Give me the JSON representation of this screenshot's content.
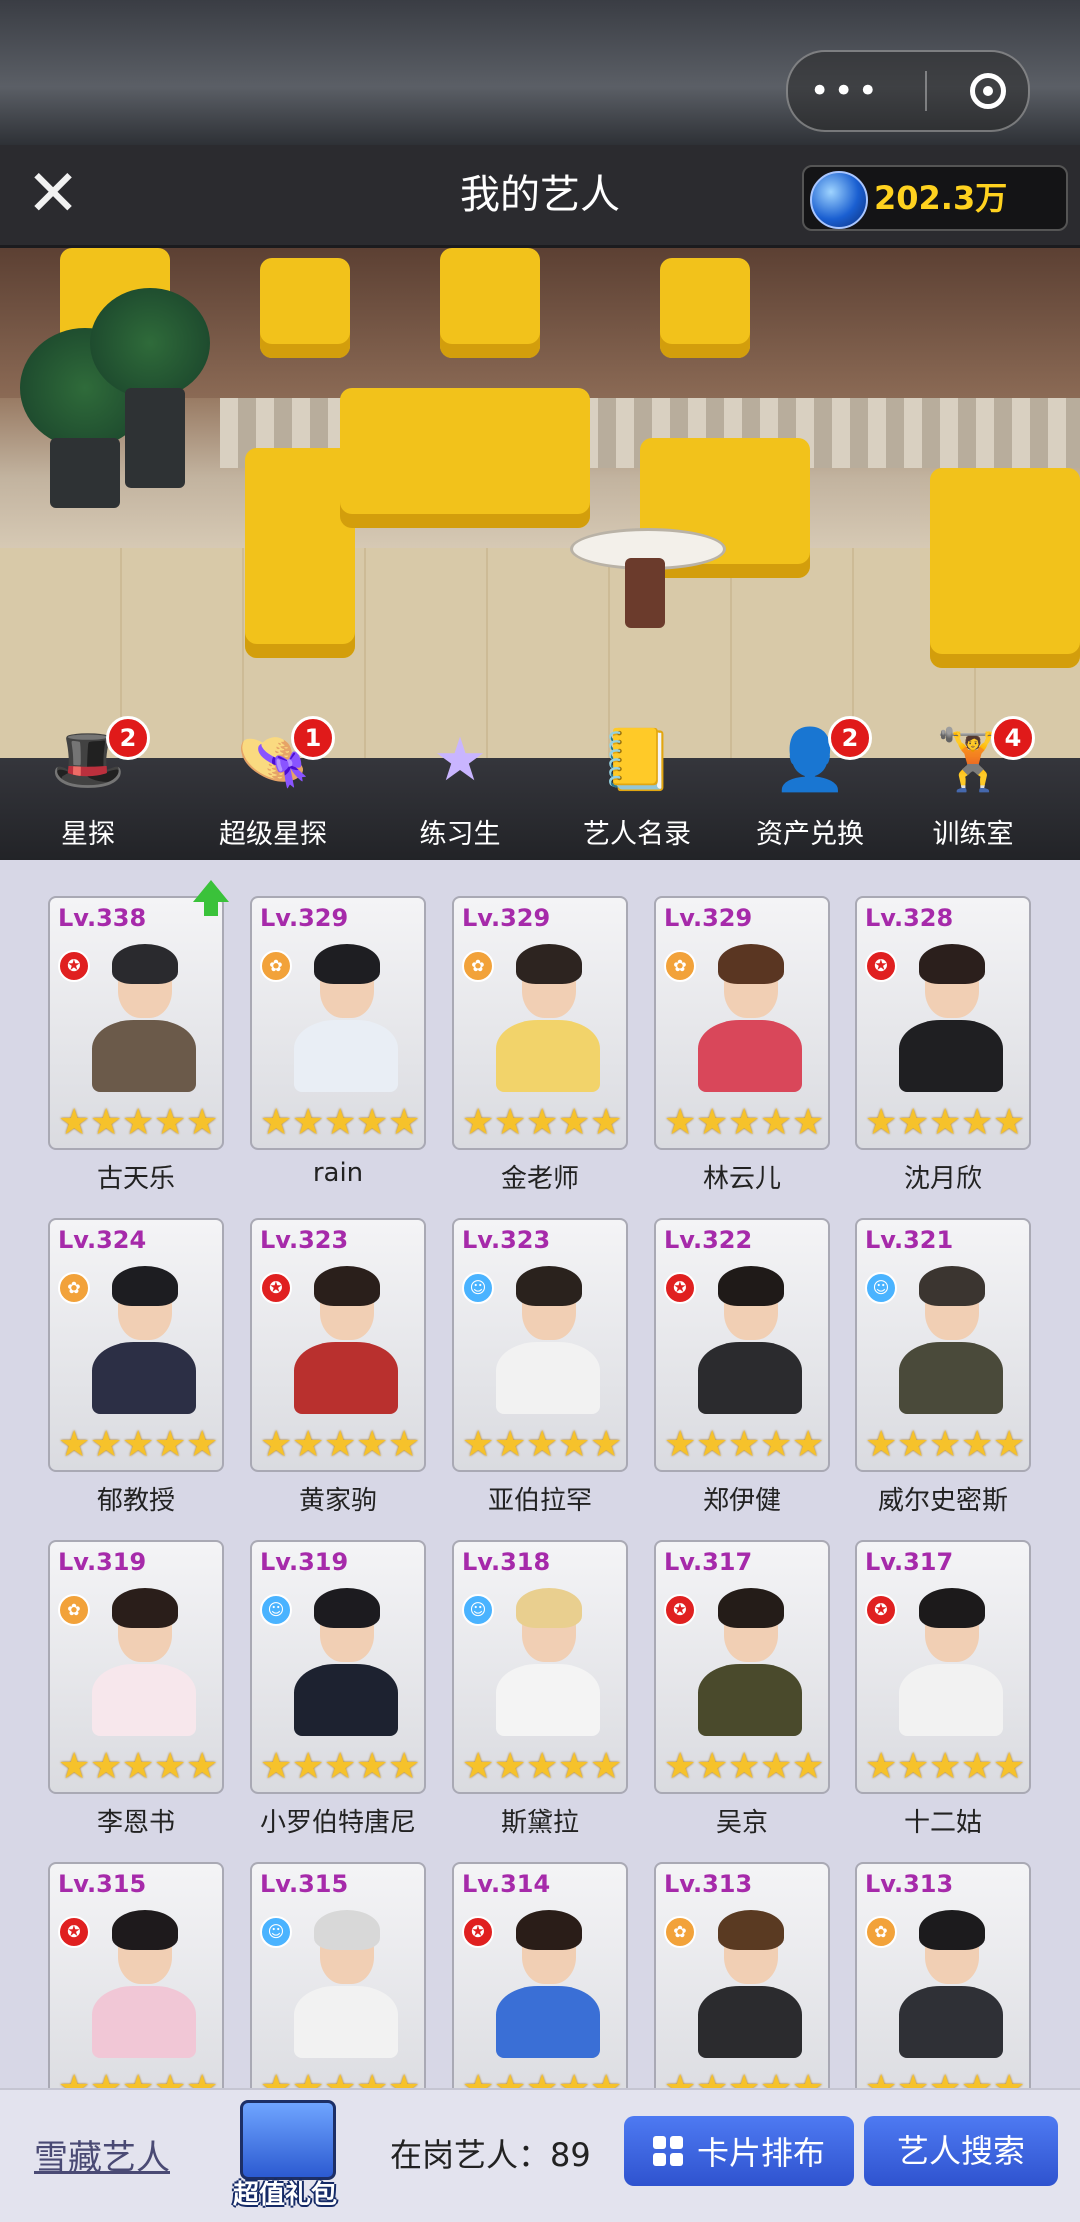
{
  "header": {
    "title": "我的艺人",
    "coins": "202.3万"
  },
  "capsule": {
    "more_icon": "more-dots-icon",
    "close_icon": "target-icon"
  },
  "actions": [
    {
      "label": "星探",
      "badge": "2",
      "icon": "scout-hat-icon"
    },
    {
      "label": "超级星探",
      "badge": "1",
      "icon": "super-scout-hat-icon"
    },
    {
      "label": "练习生",
      "badge": "",
      "icon": "trainee-star-icon"
    },
    {
      "label": "艺人名录",
      "badge": "",
      "icon": "directory-book-icon"
    },
    {
      "label": "资产兑换",
      "badge": "2",
      "icon": "asset-exchange-icon"
    },
    {
      "label": "训练室",
      "badge": "4",
      "icon": "dumbbell-icon"
    }
  ],
  "artists": [
    {
      "level": "Lv.338",
      "name": "古天乐",
      "emblem": "red",
      "up": true
    },
    {
      "level": "Lv.329",
      "name": "rain",
      "emblem": "orange",
      "up": false
    },
    {
      "level": "Lv.329",
      "name": "金老师",
      "emblem": "orange",
      "up": false
    },
    {
      "level": "Lv.329",
      "name": "林云儿",
      "emblem": "orange",
      "up": false
    },
    {
      "level": "Lv.328",
      "name": "沈月欣",
      "emblem": "red",
      "up": false
    },
    {
      "level": "Lv.324",
      "name": "郁教授",
      "emblem": "orange",
      "up": false
    },
    {
      "level": "Lv.323",
      "name": "黄家驹",
      "emblem": "red",
      "up": false
    },
    {
      "level": "Lv.323",
      "name": "亚伯拉罕",
      "emblem": "blue",
      "up": false
    },
    {
      "level": "Lv.322",
      "name": "郑伊健",
      "emblem": "red",
      "up": false
    },
    {
      "level": "Lv.321",
      "name": "威尔史密斯",
      "emblem": "blue",
      "up": false
    },
    {
      "level": "Lv.319",
      "name": "李恩书",
      "emblem": "orange",
      "up": false
    },
    {
      "level": "Lv.319",
      "name": "小罗伯特唐尼",
      "emblem": "blue",
      "up": false
    },
    {
      "level": "Lv.318",
      "name": "斯黛拉",
      "emblem": "blue",
      "up": false
    },
    {
      "level": "Lv.317",
      "name": "吴京",
      "emblem": "red",
      "up": false
    },
    {
      "level": "Lv.317",
      "name": "十二姑",
      "emblem": "red",
      "up": false
    },
    {
      "level": "Lv.315",
      "name": "",
      "emblem": "red",
      "up": false
    },
    {
      "level": "Lv.315",
      "name": "",
      "emblem": "blue",
      "up": false
    },
    {
      "level": "Lv.314",
      "name": "",
      "emblem": "red",
      "up": false
    },
    {
      "level": "Lv.313",
      "name": "",
      "emblem": "orange",
      "up": false
    },
    {
      "level": "Lv.313",
      "name": "",
      "emblem": "orange",
      "up": false
    }
  ],
  "stars_per_card": 5,
  "bottom": {
    "snow_link": "雪藏艺人",
    "gift_label": "超值礼包",
    "on_duty": "在岗艺人：89",
    "layout_button": "卡片排布",
    "search_button": "艺人搜索"
  },
  "colors": {
    "level_text": "#a62aaa",
    "star": "#f6c22b",
    "badge": "#e01a1a",
    "button": "#3f66e0",
    "coin_text": "#ffd21f"
  }
}
